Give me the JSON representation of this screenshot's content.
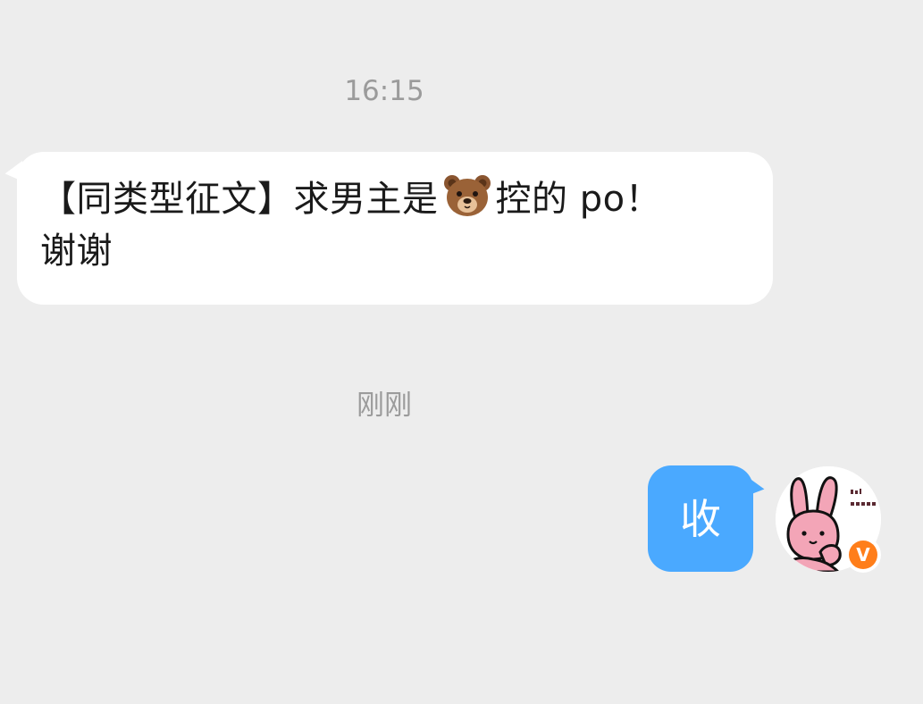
{
  "messages": [
    {
      "timestamp": "16:15",
      "direction": "incoming",
      "text_before": "【同类型征文】求男主是",
      "emoji": "bear-face",
      "text_after": "控的 po！\n谢谢"
    },
    {
      "timestamp": "刚刚",
      "direction": "outgoing",
      "text": "收"
    }
  ],
  "avatar": {
    "icon": "pink-bunny-avatar-icon",
    "badge": "V"
  },
  "colors": {
    "background": "#ededed",
    "incoming_bubble": "#ffffff",
    "outgoing_bubble": "#4aa9ff",
    "timestamp_text": "#9b9b9b",
    "verified_badge": "#ff7e1a"
  }
}
